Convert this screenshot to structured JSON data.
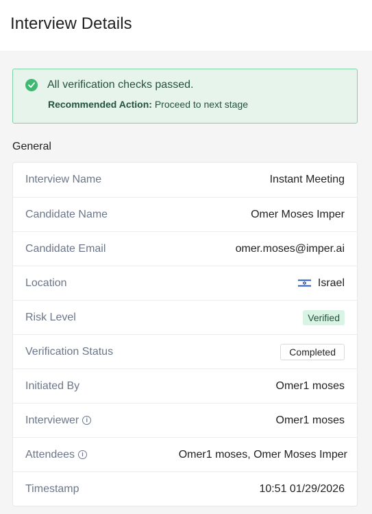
{
  "header": {
    "title": "Interview Details"
  },
  "alert": {
    "icon": "check-circle-icon",
    "title": "All verification checks passed.",
    "action_label": "Recommended Action:",
    "action_value": "Proceed to next stage",
    "color": "#3fb871"
  },
  "general": {
    "title": "General",
    "rows": {
      "interview_name": {
        "label": "Interview Name",
        "value": "Instant Meeting"
      },
      "candidate_name": {
        "label": "Candidate Name",
        "value": "Omer Moses Imper"
      },
      "candidate_email": {
        "label": "Candidate Email",
        "value": "omer.moses@imper.ai"
      },
      "location": {
        "label": "Location",
        "value": "Israel",
        "icon": "israel-flag-icon"
      },
      "risk_level": {
        "label": "Risk Level",
        "value": "Verified"
      },
      "verification_status": {
        "label": "Verification Status",
        "value": "Completed"
      },
      "initiated_by": {
        "label": "Initiated By",
        "value": "Omer1 moses"
      },
      "interviewer": {
        "label": "Interviewer",
        "value": "Omer1 moses",
        "icon": "info-icon"
      },
      "attendees": {
        "label": "Attendees",
        "value": "Omer1 moses, Omer Moses Imper",
        "icon": "info-icon"
      },
      "timestamp": {
        "label": "Timestamp",
        "value": "10:51 01/29/2026"
      }
    }
  }
}
